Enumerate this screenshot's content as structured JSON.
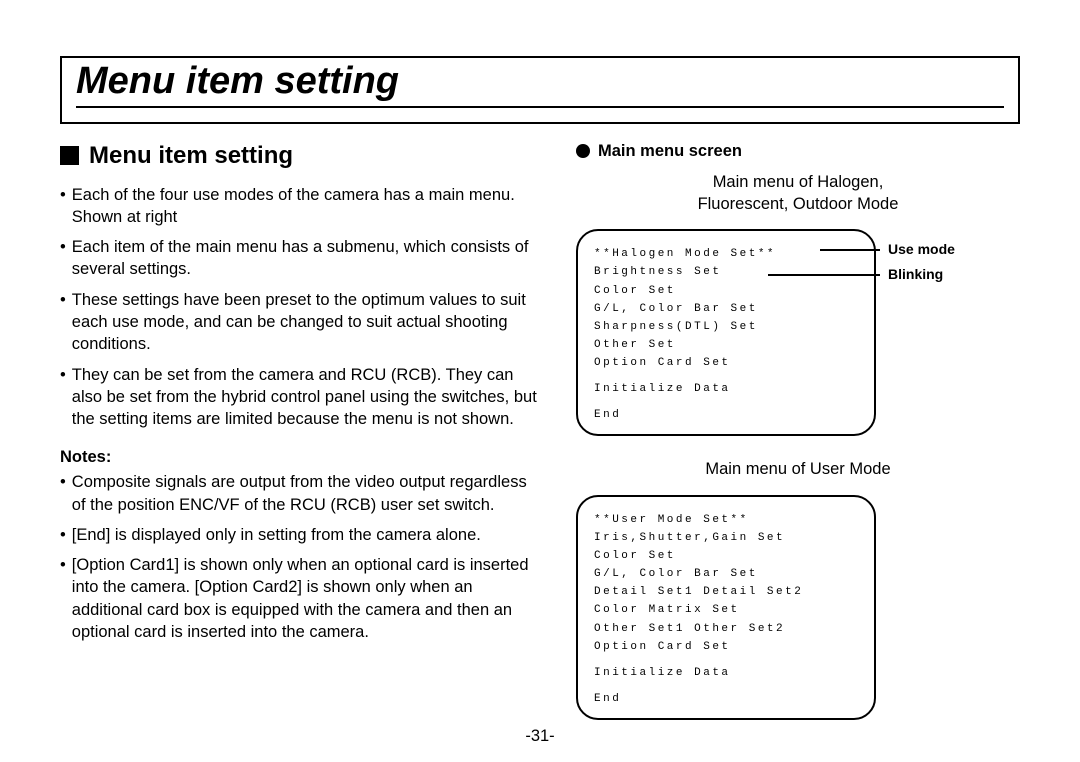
{
  "title": "Menu item setting",
  "section_heading": "Menu item setting",
  "bullets_main": [
    "Each of the four use modes of the camera has a main menu. Shown at right",
    "Each item of the main menu has a submenu, which consists of several settings.",
    "These settings have been preset to the optimum values to suit each use mode, and can be changed to suit actual shooting conditions.",
    "They can be set from the camera and RCU (RCB). They can also be set from the hybrid control panel using the switches, but the setting items are limited because the menu is not shown."
  ],
  "notes_heading": "Notes:",
  "bullets_notes": [
    "Composite signals are output from the video output regardless of the position ENC/VF of the RCU (RCB) user set switch.",
    "[End] is displayed only in setting from the camera alone.",
    "[Option Card1] is shown only when an optional card is inserted into the camera. [Option Card2] is shown only when an additional card box is equipped with the camera and then an optional card is inserted into the camera."
  ],
  "right_heading": "Main menu screen",
  "caption1_line1": "Main menu of Halogen,",
  "caption1_line2": "Fluorescent, Outdoor Mode",
  "callout_use_mode": "Use mode",
  "callout_blinking": "Blinking",
  "screen1": {
    "l0": "**Halogen Mode Set**",
    "l1": "Brightness Set",
    "l2": "Color Set",
    "l3": "G/L, Color Bar Set",
    "l4": "Sharpness(DTL) Set",
    "l5": "Other Set",
    "l6": "Option Card Set",
    "l7": "Initialize Data",
    "l8": "End"
  },
  "caption2": "Main menu of User Mode",
  "screen2": {
    "l0": "**User Mode Set**",
    "l1": "Iris,Shutter,Gain Set",
    "l2": "Color Set",
    "l3": "G/L, Color Bar Set",
    "l4": "Detail Set1 Detail Set2",
    "l5": "Color Matrix Set",
    "l6": "Other Set1   Other Set2",
    "l7": "Option Card Set",
    "l8": "Initialize Data",
    "l9": "End"
  },
  "page_number": "-31-"
}
